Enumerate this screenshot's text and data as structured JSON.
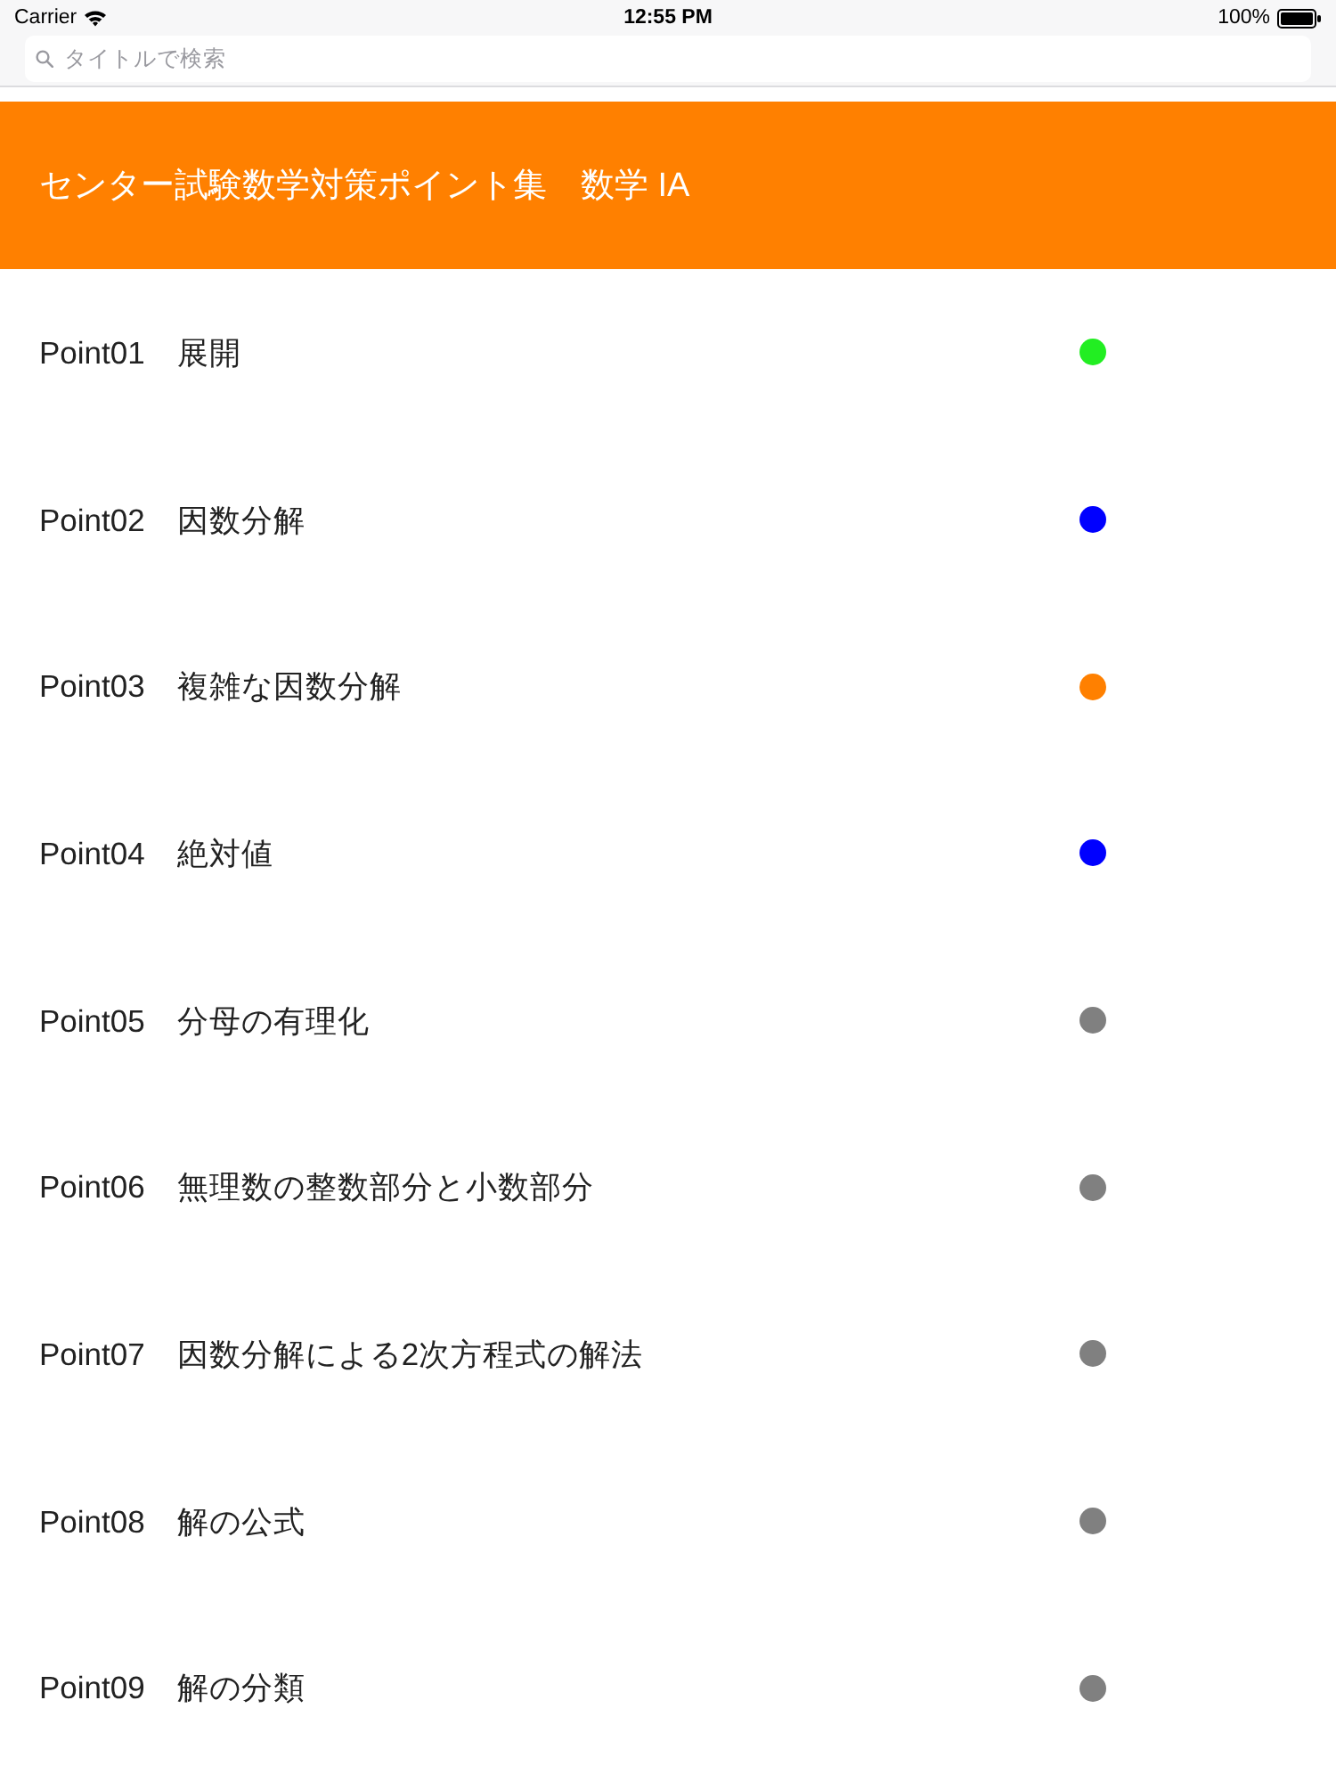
{
  "status_bar": {
    "carrier": "Carrier",
    "time": "12:55 PM",
    "battery": "100%"
  },
  "search": {
    "placeholder": "タイトルで検索"
  },
  "header": {
    "title": "センター試験数学対策ポイント集　数学 IA"
  },
  "points": [
    {
      "label": "Point01　展開",
      "color": "#22ee22"
    },
    {
      "label": "Point02　因数分解",
      "color": "#0000ff"
    },
    {
      "label": "Point03　複雑な因数分解",
      "color": "#ff8000"
    },
    {
      "label": "Point04　絶対値",
      "color": "#0000ff"
    },
    {
      "label": "Point05　分母の有理化",
      "color": "#808080"
    },
    {
      "label": "Point06　無理数の整数部分と小数部分",
      "color": "#808080"
    },
    {
      "label": "Point07　因数分解による2次方程式の解法",
      "color": "#808080"
    },
    {
      "label": "Point08　解の公式",
      "color": "#808080"
    },
    {
      "label": "Point09　解の分類",
      "color": "#808080"
    }
  ]
}
